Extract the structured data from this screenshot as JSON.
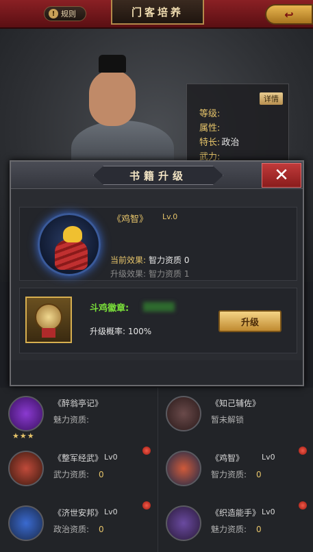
{
  "header": {
    "rules_label": "规则",
    "title": "门客培养"
  },
  "hero": {
    "detail_label": "详情",
    "attributes": [
      {
        "label": "等级:",
        "value": ""
      },
      {
        "label": "属性:",
        "value": ""
      },
      {
        "label": "特长:",
        "value": "政治"
      },
      {
        "label": "武力:",
        "value": ""
      }
    ]
  },
  "dialog": {
    "title": "书籍升级",
    "book_name": "《鸡智》",
    "book_level": "Lv.0",
    "current_effect_label": "当前效果:",
    "current_effect_value": "智力资质 0",
    "next_effect_label": "升级效果:",
    "next_effect_value": "智力资质 1",
    "requirement_name": "斗鸡徽章:",
    "rate_label": "升级概率:",
    "rate_value": "100%",
    "upgrade_label": "升级"
  },
  "books": [
    {
      "name": "《醉翁亭记》",
      "level": "",
      "attr_label": "魅力资质:",
      "attr_value": "",
      "stars": "★★★"
    },
    {
      "name": "《知己辅佐》",
      "level": "",
      "attr_label": "暂未解锁",
      "attr_value": "",
      "stars": ""
    },
    {
      "name": "《整军经武》",
      "level": "Lv0",
      "attr_label": "武力资质:",
      "attr_value": "0",
      "stars": ""
    },
    {
      "name": "《鸡智》",
      "level": "Lv0",
      "attr_label": "智力资质:",
      "attr_value": "0",
      "stars": ""
    },
    {
      "name": "《济世安邦》",
      "level": "Lv0",
      "attr_label": "政治资质:",
      "attr_value": "0",
      "stars": ""
    },
    {
      "name": "《织造能手》",
      "level": "Lv0",
      "attr_label": "魅力资质:",
      "attr_value": "0",
      "stars": ""
    }
  ],
  "icons": {
    "rules": "info-icon",
    "back": "back-arrow-icon",
    "close": "close-icon"
  }
}
